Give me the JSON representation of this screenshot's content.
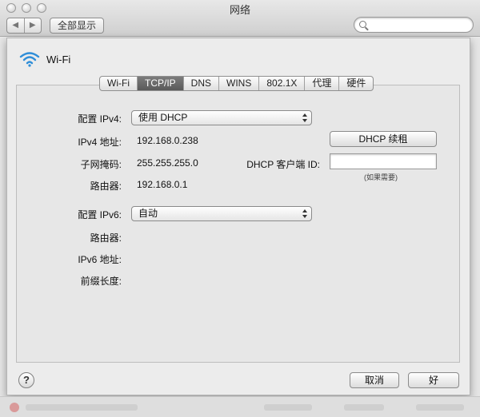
{
  "window": {
    "title": "网络"
  },
  "toolbar": {
    "back_label": "◀",
    "forward_label": "▶",
    "show_all_label": "全部显示",
    "search_placeholder": ""
  },
  "sheet": {
    "interface_name": "Wi-Fi",
    "tabs": [
      {
        "label": "Wi-Fi",
        "active": false
      },
      {
        "label": "TCP/IP",
        "active": true
      },
      {
        "label": "DNS",
        "active": false
      },
      {
        "label": "WINS",
        "active": false
      },
      {
        "label": "802.1X",
        "active": false
      },
      {
        "label": "代理",
        "active": false
      },
      {
        "label": "硬件",
        "active": false
      }
    ],
    "ipv4": {
      "configure_label": "配置 IPv4:",
      "configure_value": "使用 DHCP",
      "address_label": "IPv4 地址:",
      "address_value": "192.168.0.238",
      "subnet_label": "子网掩码:",
      "subnet_value": "255.255.255.0",
      "router_label": "路由器:",
      "router_value": "192.168.0.1",
      "renew_button": "DHCP 续租",
      "client_id_label": "DHCP 客户端 ID:",
      "client_id_value": "",
      "client_id_hint": "(如果需要)"
    },
    "ipv6": {
      "configure_label": "配置 IPv6:",
      "configure_value": "自动",
      "router_label": "路由器:",
      "address_label": "IPv6 地址:",
      "prefix_label": "前缀长度:"
    },
    "buttons": {
      "help": "?",
      "cancel": "取消",
      "ok": "好"
    }
  },
  "colors": {
    "active_tab": "#666666",
    "window_bg": "#ececec",
    "wifi_blue": "#2f8ed8"
  }
}
